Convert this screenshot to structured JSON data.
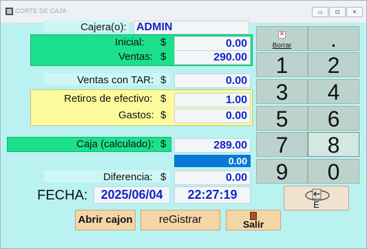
{
  "window": {
    "title": "CORTE DE CAJA",
    "minimize": "▭",
    "restore": "⊡",
    "close": "✕"
  },
  "cajero": {
    "label": "Cajera(o):",
    "value": "ADMIN"
  },
  "inicial": {
    "label": "Inicial:",
    "currency": "$",
    "value": "0.00"
  },
  "ventas": {
    "label": "Ventas:",
    "currency": "$",
    "value": "290.00"
  },
  "ventas_tar": {
    "label": "Ventas con TAR:",
    "currency": "$",
    "value": "0.00"
  },
  "retiros": {
    "label": "Retiros de efectivo:",
    "currency": "$",
    "value": "1.00"
  },
  "gastos": {
    "label": "Gastos:",
    "currency": "$",
    "value": "0.00"
  },
  "caja": {
    "label": "Caja (calculado):",
    "currency": "$",
    "value": "289.00"
  },
  "caja_input": {
    "value": "0.00"
  },
  "diferencia": {
    "label": "Diferencia:",
    "currency": "$",
    "value": "0.00"
  },
  "fecha": {
    "label": "FECHA:",
    "date": "2025/06/04",
    "time": "22:27:19"
  },
  "keypad": {
    "borrar_label": "Borrar",
    "dot": ".",
    "keys": [
      "1",
      "2",
      "3",
      "4",
      "5",
      "6",
      "7",
      "8",
      "9",
      "0"
    ],
    "enter_label": "E"
  },
  "buttons": {
    "abrir": "Abrir cajon",
    "registrar": "reGistrar",
    "salir": "Salir"
  },
  "colors": {
    "background": "#b9f2f0",
    "green": "#1ce08c",
    "yellow": "#fdfb9d",
    "value_text": "#1525c8",
    "selected_field": "#0a78d4"
  }
}
